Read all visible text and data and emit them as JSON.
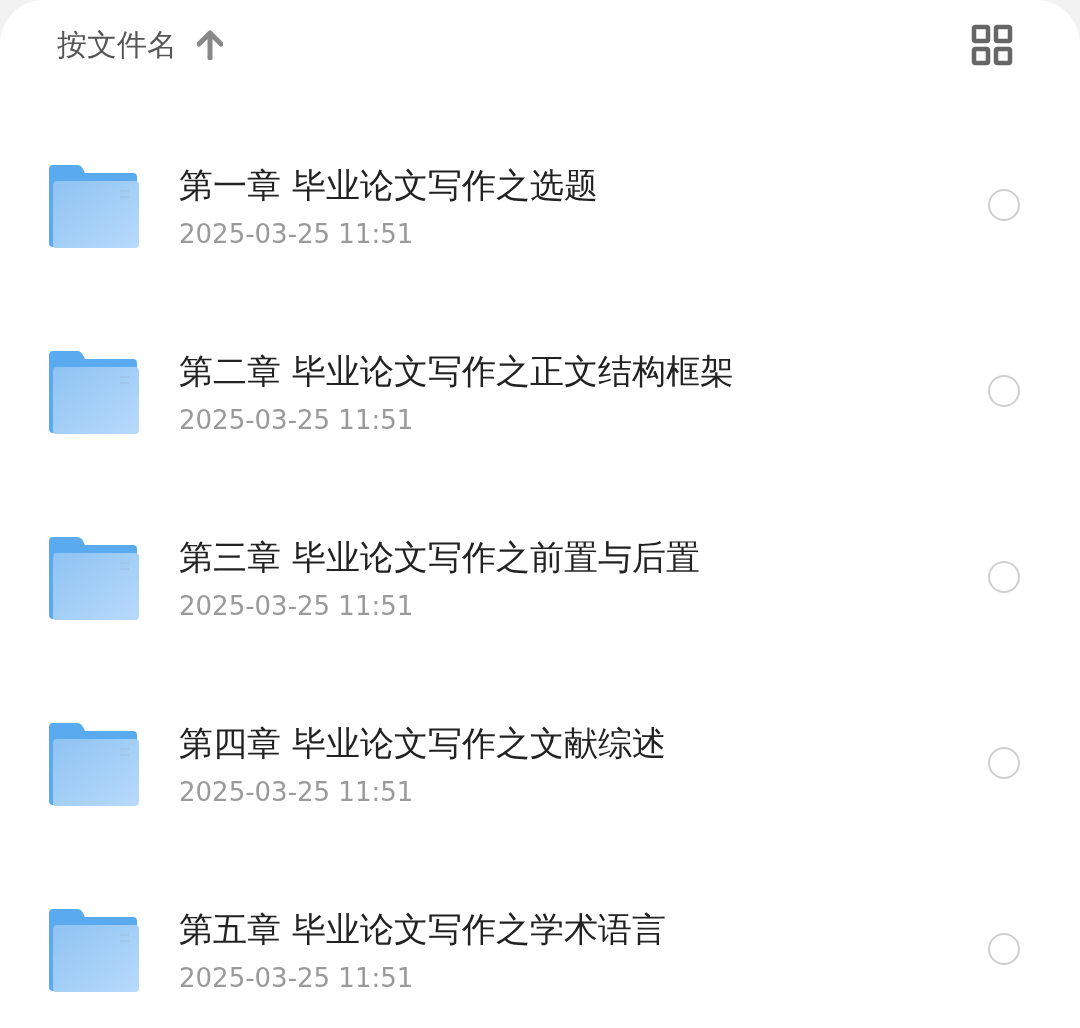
{
  "toolbar": {
    "sort_label": "按文件名"
  },
  "files": [
    {
      "name": "第一章 毕业论文写作之选题",
      "date": "2025-03-25 11:51",
      "selected": false
    },
    {
      "name": "第二章 毕业论文写作之正文结构框架",
      "date": "2025-03-25 11:51",
      "selected": false
    },
    {
      "name": "第三章 毕业论文写作之前置与后置",
      "date": "2025-03-25 11:51",
      "selected": false
    },
    {
      "name": "第四章 毕业论文写作之文献综述",
      "date": "2025-03-25 11:51",
      "selected": false
    },
    {
      "name": "第五章 毕业论文写作之学术语言",
      "date": "2025-03-25 11:51",
      "selected": false
    }
  ]
}
